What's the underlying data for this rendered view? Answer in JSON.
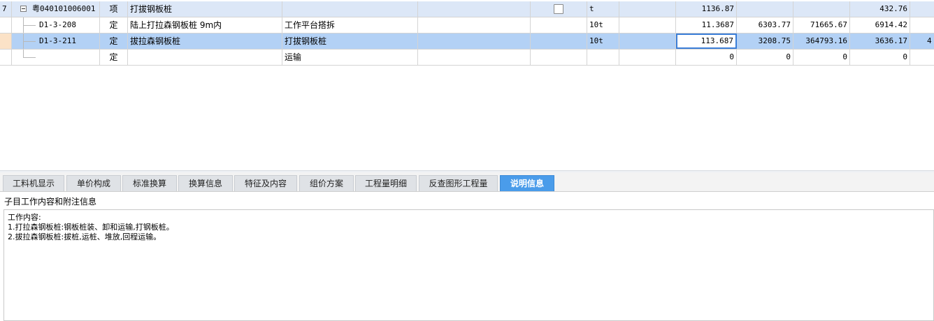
{
  "grid": {
    "rows": [
      {
        "rownum": "7",
        "code": "粤040101006001",
        "type": "项",
        "name": "打拔钢板桩",
        "spec": "",
        "extra": "",
        "unit": "t",
        "col_blank": "",
        "qty": "1136.87",
        "unit_price": "",
        "total": "",
        "c1": "432.76",
        "c2": ""
      },
      {
        "rownum": "",
        "code": "D1-3-208",
        "type": "定",
        "name": "陆上打拉森钢板桩 9m内",
        "spec": "工作平台搭拆",
        "extra": "",
        "unit": "10t",
        "col_blank": "",
        "qty": "11.3687",
        "unit_price": "6303.77",
        "total": "71665.67",
        "c1": "6914.42",
        "c2": ""
      },
      {
        "rownum": "",
        "code": "D1-3-211",
        "type": "定",
        "name": "拔拉森钢板桩",
        "spec": "打拔钢板桩",
        "extra": "",
        "unit": "10t",
        "col_blank": "",
        "qty": "113.687",
        "unit_price": "3208.75",
        "total": "364793.16",
        "c1": "3636.17",
        "c2": "4"
      },
      {
        "rownum": "",
        "code": "",
        "type": "定",
        "name": "",
        "spec": "运输",
        "extra": "",
        "unit": "",
        "col_blank": "",
        "qty": "0",
        "unit_price": "0",
        "total": "0",
        "c1": "0",
        "c2": ""
      }
    ]
  },
  "tabs": [
    {
      "label": "工料机显示"
    },
    {
      "label": "单价构成"
    },
    {
      "label": "标准换算"
    },
    {
      "label": "换算信息"
    },
    {
      "label": "特征及内容"
    },
    {
      "label": "组价方案"
    },
    {
      "label": "工程量明细"
    },
    {
      "label": "反查图形工程量"
    },
    {
      "label": "说明信息",
      "active": true
    }
  ],
  "panel": {
    "title": "子目工作内容和附注信息",
    "lines": [
      "工作内容:",
      "1.打拉森钢板桩:钢板桩装、卸和运输,打钢板桩。",
      "2.拔拉森钢板桩:拔桩,运桩、堆放,回程运输。"
    ]
  },
  "colors": {
    "item_row": "#dce7f7",
    "selected_row": "#b3d1f5",
    "active_tab": "#4a9cea"
  }
}
